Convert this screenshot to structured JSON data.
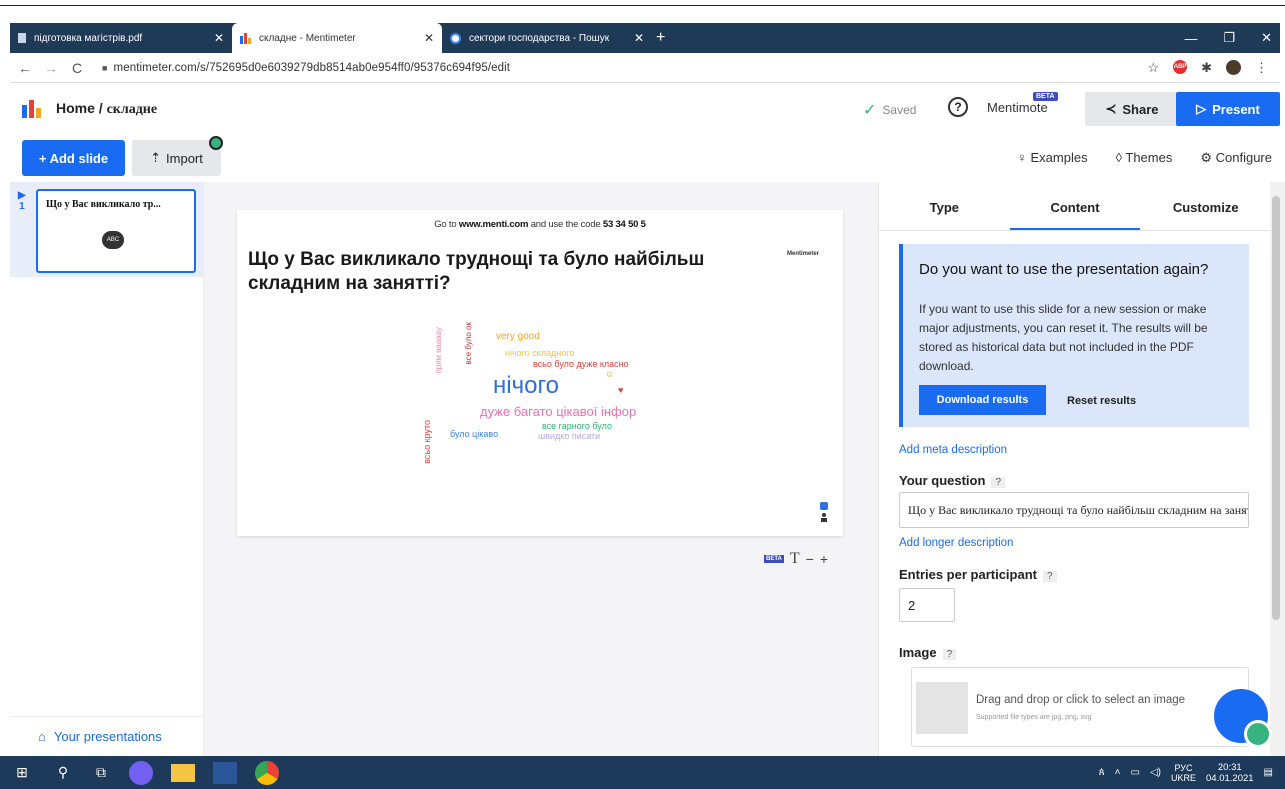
{
  "browser": {
    "tabs": [
      {
        "label": "підготовка магістрів.pdf"
      },
      {
        "label": "складне - Mentimeter"
      },
      {
        "label": "сектори господарства - Пошук"
      }
    ],
    "url": "mentimeter.com/s/752695d0e6039279db8514ab0e954ff0/95376c694f95/edit"
  },
  "header": {
    "home": "Home",
    "separator": " / ",
    "current": "складне",
    "saved": "Saved",
    "help": "?",
    "mentimote": "Mentimote",
    "beta": "BETA",
    "share": "Share",
    "present": "Present"
  },
  "toolbar": {
    "add_slide": "+ Add slide",
    "import": "Import",
    "examples": "Examples",
    "themes": "Themes",
    "configure": "Configure"
  },
  "sidebar": {
    "slide_number": "1",
    "slide_title": "Що у Вас викликало тр...",
    "your_presentations": "Your presentations"
  },
  "slide": {
    "join_prefix": "Go to ",
    "join_url": "www.menti.com",
    "join_mid": " and use the code ",
    "join_code": "53 34 50 5",
    "brand": "Mentimeter",
    "title": "Що у Вас викликало труднощі та було найбільш складним на занятті?",
    "words": [
      {
        "text": "very good",
        "color": "#f5a623"
      },
      {
        "text": "нічого складного",
        "color": "#f5c23a"
      },
      {
        "text": "всьо було дуже класно",
        "color": "#e5403a"
      },
      {
        "text": "нічого",
        "color": "#2e6fe0"
      },
      {
        "text": "дуже багато цікавої інфор",
        "color": "#ef6fae"
      },
      {
        "text": "все гарного було",
        "color": "#2bb673"
      },
      {
        "text": "було цікаво",
        "color": "#3b82f6"
      },
      {
        "text": "швидко писати",
        "color": "#b7a7ef"
      },
      {
        "text": "всьо круто",
        "color": "#e5403a"
      },
      {
        "text": "прям ваааау",
        "color": "#ef8fa8"
      },
      {
        "text": "все було ок",
        "color": "#c0393b"
      }
    ],
    "beta": "BETA"
  },
  "panel": {
    "tabs": [
      "Type",
      "Content",
      "Customize"
    ],
    "info_title": "Do you want to use the presentation again?",
    "info_text": "If you want to use this slide for a new session or make major adjustments, you can reset it. The results will be stored as historical data but not included in the PDF download.",
    "download": "Download results",
    "reset": "Reset results",
    "meta": "Add meta description",
    "question_label": "Your question",
    "question_value": "Що у Вас викликало труднощі та було найбільш складним на занятті?",
    "longer": "Add longer description",
    "entries_label": "Entries per participant",
    "entries_value": "2",
    "image_label": "Image",
    "dz_text": "Drag and drop or click to select an image",
    "dz_sub": "Supported file types are jpg, png, svg",
    "q": "?"
  },
  "taskbar": {
    "lang1": "РУС",
    "lang2": "UKRE",
    "time": "20:31",
    "date": "04.01.2021"
  }
}
